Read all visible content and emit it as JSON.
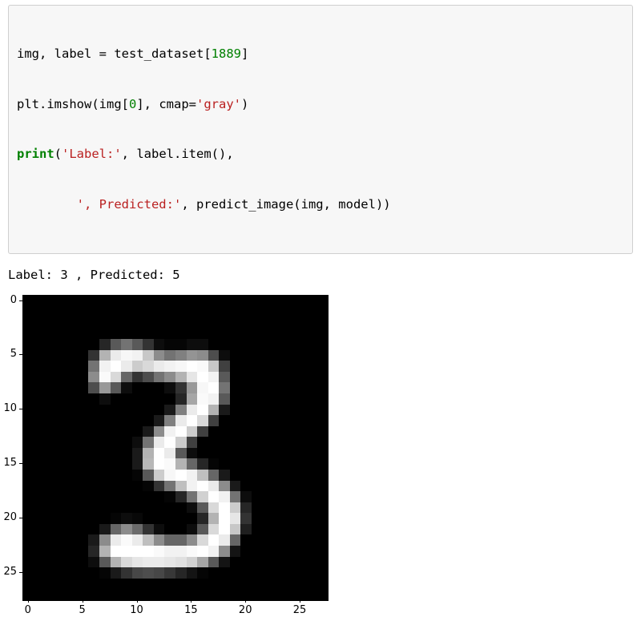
{
  "code": {
    "line1": {
      "t1": "img, label ",
      "op1": "=",
      "t2": " test_dataset[",
      "idx": "1889",
      "t3": "]"
    },
    "line2": {
      "t1": "plt.imshow(img[",
      "zero": "0",
      "t2": "], cmap",
      "op1": "=",
      "str_gray": "'gray'",
      "t3": ")"
    },
    "line3": {
      "kw_print": "print",
      "paren": "(",
      "str_label": "'Label:'",
      "t1": ", label.item(),"
    },
    "line4": {
      "indent": "        ",
      "str_pred": "', Predicted:'",
      "t1": ", predict_image(img, model))"
    }
  },
  "output": "Label: 3 , Predicted: 5",
  "chart_data": {
    "type": "heatmap",
    "title": "",
    "xlabel": "",
    "ylabel": "",
    "xlim": [
      -0.5,
      27.5
    ],
    "ylim": [
      27.5,
      -0.5
    ],
    "xticks": [
      0,
      5,
      10,
      15,
      20,
      25
    ],
    "yticks": [
      0,
      5,
      10,
      15,
      20,
      25
    ],
    "cmap": "gray",
    "rows": 28,
    "cols": 28,
    "values": [
      [
        0,
        0,
        0,
        0,
        0,
        0,
        0,
        0,
        0,
        0,
        0,
        0,
        0,
        0,
        0,
        0,
        0,
        0,
        0,
        0,
        0,
        0,
        0,
        0,
        0,
        0,
        0,
        0
      ],
      [
        0,
        0,
        0,
        0,
        0,
        0,
        0,
        0,
        0,
        0,
        0,
        0,
        0,
        0,
        0,
        0,
        0,
        0,
        0,
        0,
        0,
        0,
        0,
        0,
        0,
        0,
        0,
        0
      ],
      [
        0,
        0,
        0,
        0,
        0,
        0,
        0,
        0,
        0,
        0,
        0,
        0,
        0,
        0,
        0,
        0,
        0,
        0,
        0,
        0,
        0,
        0,
        0,
        0,
        0,
        0,
        0,
        0
      ],
      [
        0,
        0,
        0,
        0,
        0,
        0,
        0,
        0,
        0,
        0,
        0,
        0,
        0,
        0,
        0,
        0,
        0,
        0,
        0,
        0,
        0,
        0,
        0,
        0,
        0,
        0,
        0,
        0
      ],
      [
        0,
        0,
        0,
        0,
        0,
        0,
        0,
        0.15,
        0.35,
        0.45,
        0.35,
        0.2,
        0.05,
        0.02,
        0.02,
        0.05,
        0.05,
        0,
        0,
        0,
        0,
        0,
        0,
        0,
        0,
        0,
        0,
        0
      ],
      [
        0,
        0,
        0,
        0,
        0,
        0,
        0.2,
        0.7,
        0.92,
        0.97,
        0.95,
        0.78,
        0.55,
        0.45,
        0.5,
        0.58,
        0.55,
        0.3,
        0.05,
        0,
        0,
        0,
        0,
        0,
        0,
        0,
        0,
        0
      ],
      [
        0,
        0,
        0,
        0,
        0,
        0,
        0.45,
        0.95,
        1.0,
        0.92,
        0.8,
        0.85,
        0.92,
        0.95,
        0.97,
        1.0,
        0.98,
        0.78,
        0.25,
        0,
        0,
        0,
        0,
        0,
        0,
        0,
        0,
        0
      ],
      [
        0,
        0,
        0,
        0,
        0,
        0,
        0.55,
        0.98,
        0.85,
        0.4,
        0.2,
        0.3,
        0.45,
        0.55,
        0.7,
        0.9,
        1.0,
        0.95,
        0.35,
        0,
        0,
        0,
        0,
        0,
        0,
        0,
        0,
        0
      ],
      [
        0,
        0,
        0,
        0,
        0,
        0,
        0.3,
        0.6,
        0.35,
        0.05,
        0,
        0,
        0,
        0.05,
        0.2,
        0.6,
        0.97,
        1.0,
        0.45,
        0,
        0,
        0,
        0,
        0,
        0,
        0,
        0,
        0
      ],
      [
        0,
        0,
        0,
        0,
        0,
        0,
        0,
        0.05,
        0,
        0,
        0,
        0,
        0,
        0,
        0.15,
        0.65,
        0.98,
        0.95,
        0.35,
        0,
        0,
        0,
        0,
        0,
        0,
        0,
        0,
        0
      ],
      [
        0,
        0,
        0,
        0,
        0,
        0,
        0,
        0,
        0,
        0,
        0,
        0,
        0,
        0.1,
        0.5,
        0.92,
        1.0,
        0.7,
        0.1,
        0,
        0,
        0,
        0,
        0,
        0,
        0,
        0,
        0
      ],
      [
        0,
        0,
        0,
        0,
        0,
        0,
        0,
        0,
        0,
        0,
        0,
        0,
        0.1,
        0.5,
        0.92,
        1.0,
        0.85,
        0.25,
        0,
        0,
        0,
        0,
        0,
        0,
        0,
        0,
        0,
        0
      ],
      [
        0,
        0,
        0,
        0,
        0,
        0,
        0,
        0,
        0,
        0,
        0,
        0.1,
        0.55,
        0.95,
        1.0,
        0.8,
        0.25,
        0,
        0,
        0,
        0,
        0,
        0,
        0,
        0,
        0,
        0,
        0
      ],
      [
        0,
        0,
        0,
        0,
        0,
        0,
        0,
        0,
        0,
        0,
        0.05,
        0.45,
        0.92,
        1.0,
        0.8,
        0.25,
        0,
        0,
        0,
        0,
        0,
        0,
        0,
        0,
        0,
        0,
        0,
        0
      ],
      [
        0,
        0,
        0,
        0,
        0,
        0,
        0,
        0,
        0,
        0,
        0.1,
        0.7,
        1.0,
        0.92,
        0.35,
        0.05,
        0,
        0,
        0,
        0,
        0,
        0,
        0,
        0,
        0,
        0,
        0,
        0
      ],
      [
        0,
        0,
        0,
        0,
        0,
        0,
        0,
        0,
        0,
        0,
        0.1,
        0.72,
        1.0,
        0.98,
        0.7,
        0.4,
        0.15,
        0.02,
        0,
        0,
        0,
        0,
        0,
        0,
        0,
        0,
        0,
        0
      ],
      [
        0,
        0,
        0,
        0,
        0,
        0,
        0,
        0,
        0,
        0,
        0.02,
        0.35,
        0.8,
        0.97,
        1.0,
        0.95,
        0.75,
        0.4,
        0.1,
        0,
        0,
        0,
        0,
        0,
        0,
        0,
        0,
        0
      ],
      [
        0,
        0,
        0,
        0,
        0,
        0,
        0,
        0,
        0,
        0,
        0,
        0.02,
        0.2,
        0.45,
        0.75,
        0.95,
        1.0,
        0.92,
        0.55,
        0.1,
        0,
        0,
        0,
        0,
        0,
        0,
        0,
        0
      ],
      [
        0,
        0,
        0,
        0,
        0,
        0,
        0,
        0,
        0,
        0,
        0,
        0,
        0,
        0.02,
        0.15,
        0.45,
        0.82,
        1.0,
        0.95,
        0.45,
        0.05,
        0,
        0,
        0,
        0,
        0,
        0,
        0
      ],
      [
        0,
        0,
        0,
        0,
        0,
        0,
        0,
        0,
        0,
        0,
        0,
        0,
        0,
        0,
        0,
        0.05,
        0.35,
        0.85,
        1.0,
        0.8,
        0.15,
        0,
        0,
        0,
        0,
        0,
        0,
        0
      ],
      [
        0,
        0,
        0,
        0,
        0,
        0,
        0,
        0,
        0.02,
        0.05,
        0.03,
        0,
        0,
        0,
        0,
        0,
        0.15,
        0.7,
        1.0,
        0.9,
        0.2,
        0,
        0,
        0,
        0,
        0,
        0,
        0
      ],
      [
        0,
        0,
        0,
        0,
        0,
        0,
        0,
        0.1,
        0.4,
        0.55,
        0.42,
        0.2,
        0.05,
        0,
        0,
        0.05,
        0.35,
        0.85,
        1.0,
        0.78,
        0.12,
        0,
        0,
        0,
        0,
        0,
        0,
        0
      ],
      [
        0,
        0,
        0,
        0,
        0,
        0,
        0.1,
        0.55,
        0.92,
        0.98,
        0.92,
        0.75,
        0.55,
        0.4,
        0.4,
        0.55,
        0.85,
        1.0,
        0.92,
        0.4,
        0,
        0,
        0,
        0,
        0,
        0,
        0,
        0
      ],
      [
        0,
        0,
        0,
        0,
        0,
        0,
        0.15,
        0.7,
        1.0,
        1.0,
        1.0,
        1.0,
        0.98,
        0.95,
        0.95,
        0.98,
        1.0,
        0.95,
        0.55,
        0.08,
        0,
        0,
        0,
        0,
        0,
        0,
        0,
        0
      ],
      [
        0,
        0,
        0,
        0,
        0,
        0,
        0.05,
        0.35,
        0.7,
        0.85,
        0.9,
        0.92,
        0.92,
        0.9,
        0.88,
        0.82,
        0.65,
        0.35,
        0.08,
        0,
        0,
        0,
        0,
        0,
        0,
        0,
        0,
        0
      ],
      [
        0,
        0,
        0,
        0,
        0,
        0,
        0,
        0.02,
        0.1,
        0.2,
        0.28,
        0.3,
        0.28,
        0.22,
        0.15,
        0.08,
        0.02,
        0,
        0,
        0,
        0,
        0,
        0,
        0,
        0,
        0,
        0,
        0
      ],
      [
        0,
        0,
        0,
        0,
        0,
        0,
        0,
        0,
        0,
        0,
        0,
        0,
        0,
        0,
        0,
        0,
        0,
        0,
        0,
        0,
        0,
        0,
        0,
        0,
        0,
        0,
        0,
        0
      ],
      [
        0,
        0,
        0,
        0,
        0,
        0,
        0,
        0,
        0,
        0,
        0,
        0,
        0,
        0,
        0,
        0,
        0,
        0,
        0,
        0,
        0,
        0,
        0,
        0,
        0,
        0,
        0,
        0
      ]
    ]
  }
}
